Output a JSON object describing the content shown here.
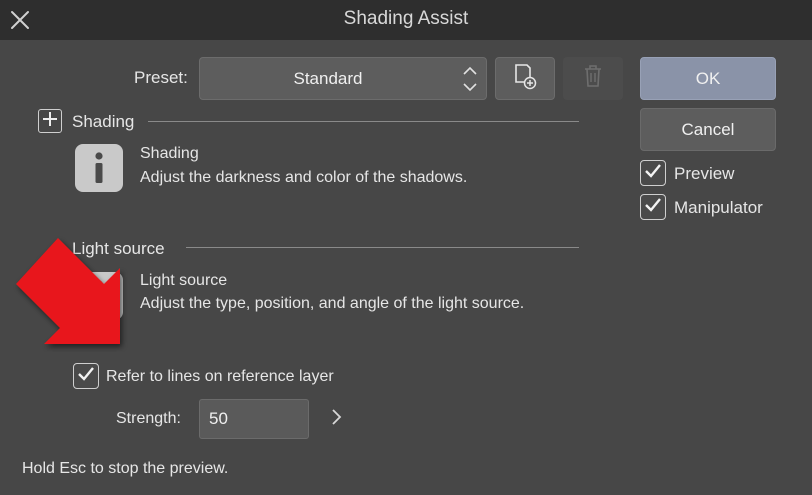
{
  "window": {
    "title": "Shading Assist"
  },
  "preset": {
    "label": "Preset:",
    "value": "Standard"
  },
  "buttons": {
    "ok": "OK",
    "cancel": "Cancel"
  },
  "options": {
    "preview": "Preview",
    "manipulator": "Manipulator"
  },
  "shading_section": {
    "header": "Shading",
    "title": "Shading",
    "description": "Adjust the darkness and color of the shadows."
  },
  "light_section": {
    "header": "Light source",
    "title": "Light source",
    "description": "Adjust the type, position, and angle of the light source."
  },
  "reference": {
    "label": "Refer to lines on reference layer",
    "checked": true
  },
  "strength": {
    "label": "Strength:",
    "value": "50"
  },
  "footer": {
    "hint": "Hold Esc to stop the preview."
  },
  "colors": {
    "annotation_arrow": "#e8141a",
    "ok_button": "#8a93a8"
  },
  "icons": [
    "close-icon",
    "up-down-chevron-icon",
    "add-preset-icon",
    "trash-icon",
    "plus-icon",
    "info-icon",
    "checkmark-icon",
    "chevron-right-icon",
    "red-arrow-annotation"
  ]
}
